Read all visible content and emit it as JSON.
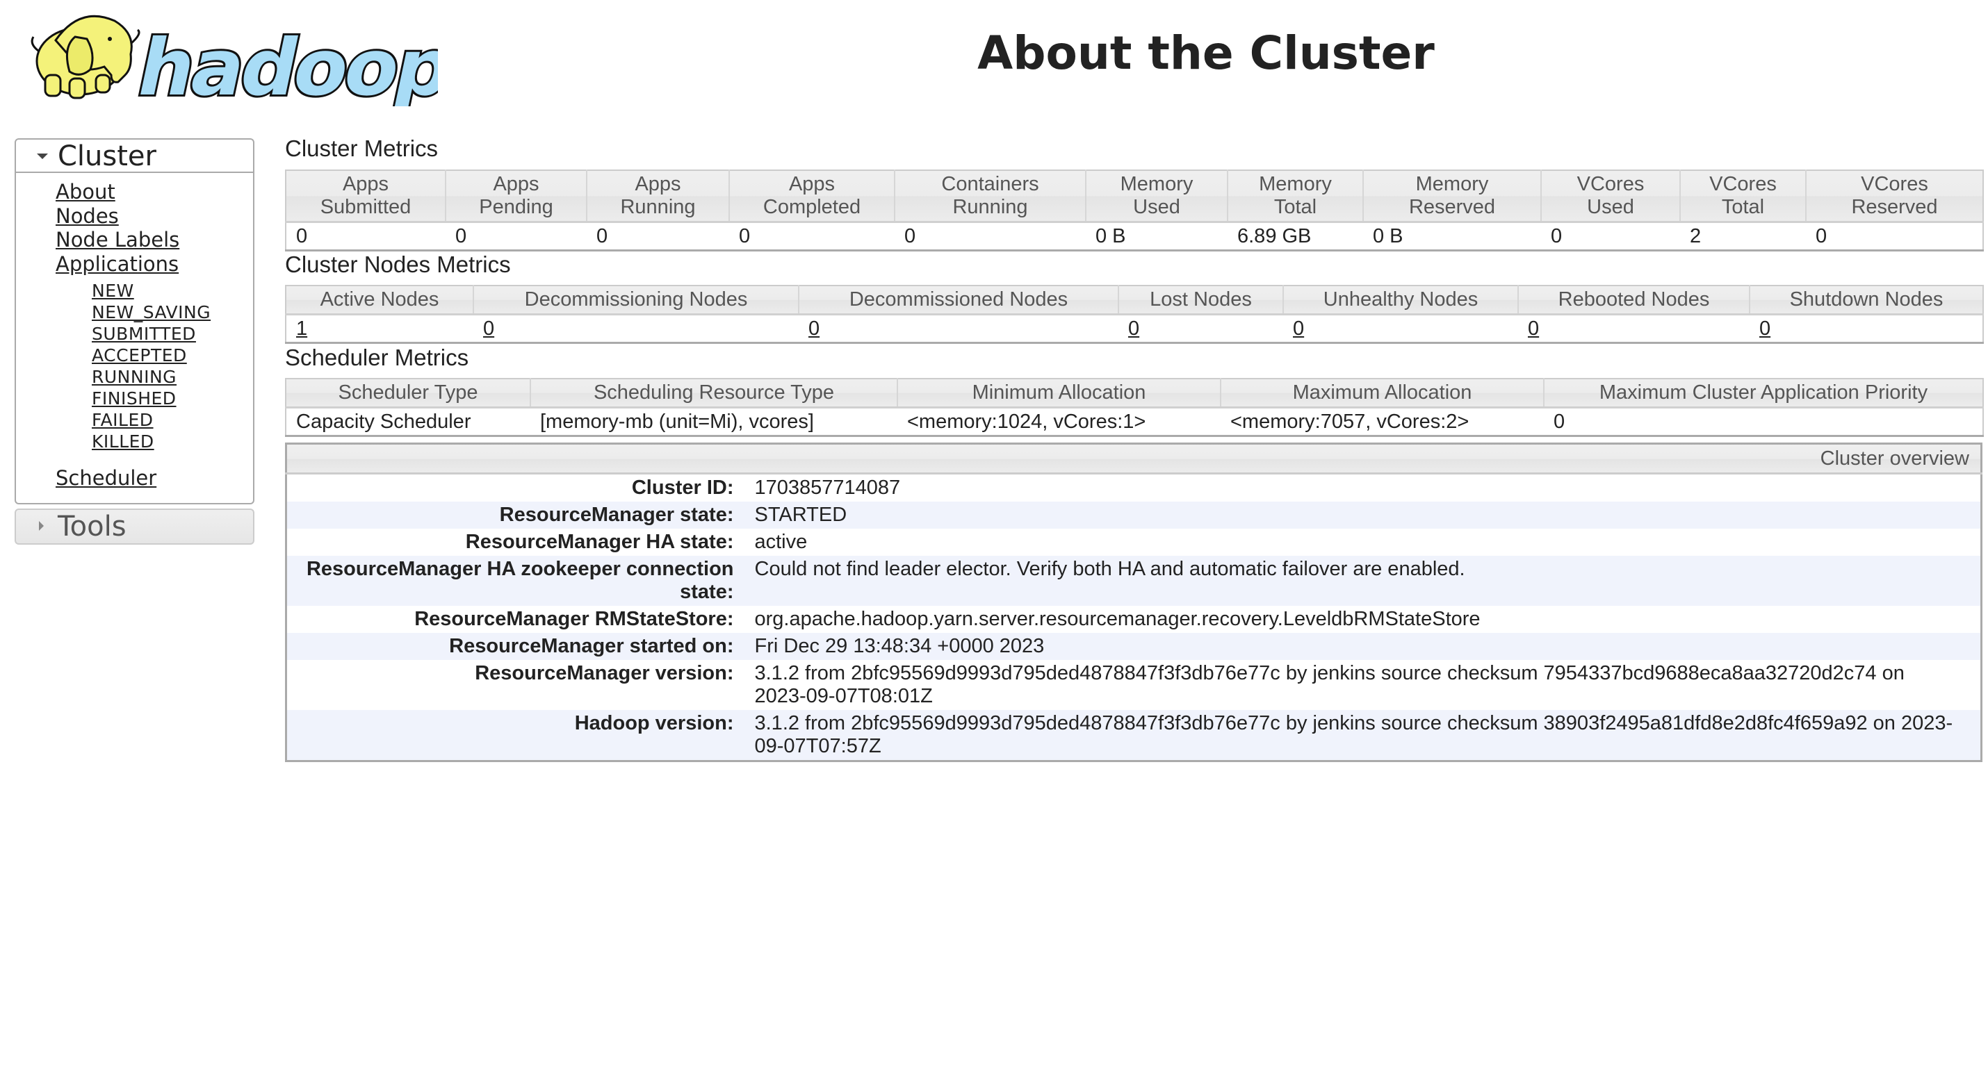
{
  "header": {
    "logo_text": "hadoop",
    "title": "About the Cluster"
  },
  "sidebar": {
    "cluster_label": "Cluster",
    "links": [
      {
        "label": "About"
      },
      {
        "label": "Nodes"
      },
      {
        "label": "Node Labels"
      },
      {
        "label": "Applications"
      }
    ],
    "app_states": [
      {
        "label": "NEW"
      },
      {
        "label": "NEW_SAVING"
      },
      {
        "label": "SUBMITTED"
      },
      {
        "label": "ACCEPTED"
      },
      {
        "label": "RUNNING"
      },
      {
        "label": "FINISHED"
      },
      {
        "label": "FAILED"
      },
      {
        "label": "KILLED"
      }
    ],
    "scheduler_label": "Scheduler",
    "tools_label": "Tools"
  },
  "cluster_metrics": {
    "title": "Cluster Metrics",
    "headers": [
      [
        "Apps",
        "Submitted"
      ],
      [
        "Apps",
        "Pending"
      ],
      [
        "Apps",
        "Running"
      ],
      [
        "Apps",
        "Completed"
      ],
      [
        "Containers",
        "Running"
      ],
      [
        "Memory",
        "Used"
      ],
      [
        "Memory",
        "Total"
      ],
      [
        "Memory",
        "Reserved"
      ],
      [
        "VCores",
        "Used"
      ],
      [
        "VCores",
        "Total"
      ],
      [
        "VCores",
        "Reserved"
      ]
    ],
    "values": [
      "0",
      "0",
      "0",
      "0",
      "0",
      "0 B",
      "6.89 GB",
      "0 B",
      "0",
      "2",
      "0"
    ]
  },
  "nodes_metrics": {
    "title": "Cluster Nodes Metrics",
    "headers": [
      "Active Nodes",
      "Decommissioning Nodes",
      "Decommissioned Nodes",
      "Lost Nodes",
      "Unhealthy Nodes",
      "Rebooted Nodes",
      "Shutdown Nodes"
    ],
    "values": [
      "1",
      "0",
      "0",
      "0",
      "0",
      "0",
      "0"
    ]
  },
  "scheduler_metrics": {
    "title": "Scheduler Metrics",
    "headers": [
      "Scheduler Type",
      "Scheduling Resource Type",
      "Minimum Allocation",
      "Maximum Allocation",
      "Maximum Cluster Application Priority"
    ],
    "values": [
      "Capacity Scheduler",
      "[memory-mb (unit=Mi), vcores]",
      "<memory:1024, vCores:1>",
      "<memory:7057, vCores:2>",
      "0"
    ]
  },
  "overview": {
    "title": "Cluster overview",
    "rows": [
      {
        "label": "Cluster ID:",
        "value": "1703857714087"
      },
      {
        "label": "ResourceManager state:",
        "value": "STARTED"
      },
      {
        "label": "ResourceManager HA state:",
        "value": "active"
      },
      {
        "label": "ResourceManager HA zookeeper connection state:",
        "value": "Could not find leader elector. Verify both HA and automatic failover are enabled."
      },
      {
        "label": "ResourceManager RMStateStore:",
        "value": "org.apache.hadoop.yarn.server.resourcemanager.recovery.LeveldbRMStateStore"
      },
      {
        "label": "ResourceManager started on:",
        "value": "Fri Dec 29 13:48:34 +0000 2023"
      },
      {
        "label": "ResourceManager version:",
        "value": "3.1.2 from 2bfc95569d9993d795ded4878847f3f3db76e77c by jenkins source checksum 7954337bcd9688eca8aa32720d2c74 on 2023-09-07T08:01Z"
      },
      {
        "label": "Hadoop version:",
        "value": "3.1.2 from 2bfc95569d9993d795ded4878847f3f3db76e77c by jenkins source checksum 38903f2495a81dfd8e2d8fc4f659a92 on 2023-09-07T07:57Z"
      }
    ]
  },
  "colors": {
    "logo_yellow": "#f4f27a",
    "logo_blue": "#a8dcf6",
    "row_alt": "#f0f3fc",
    "header_bg": "#ececec"
  }
}
